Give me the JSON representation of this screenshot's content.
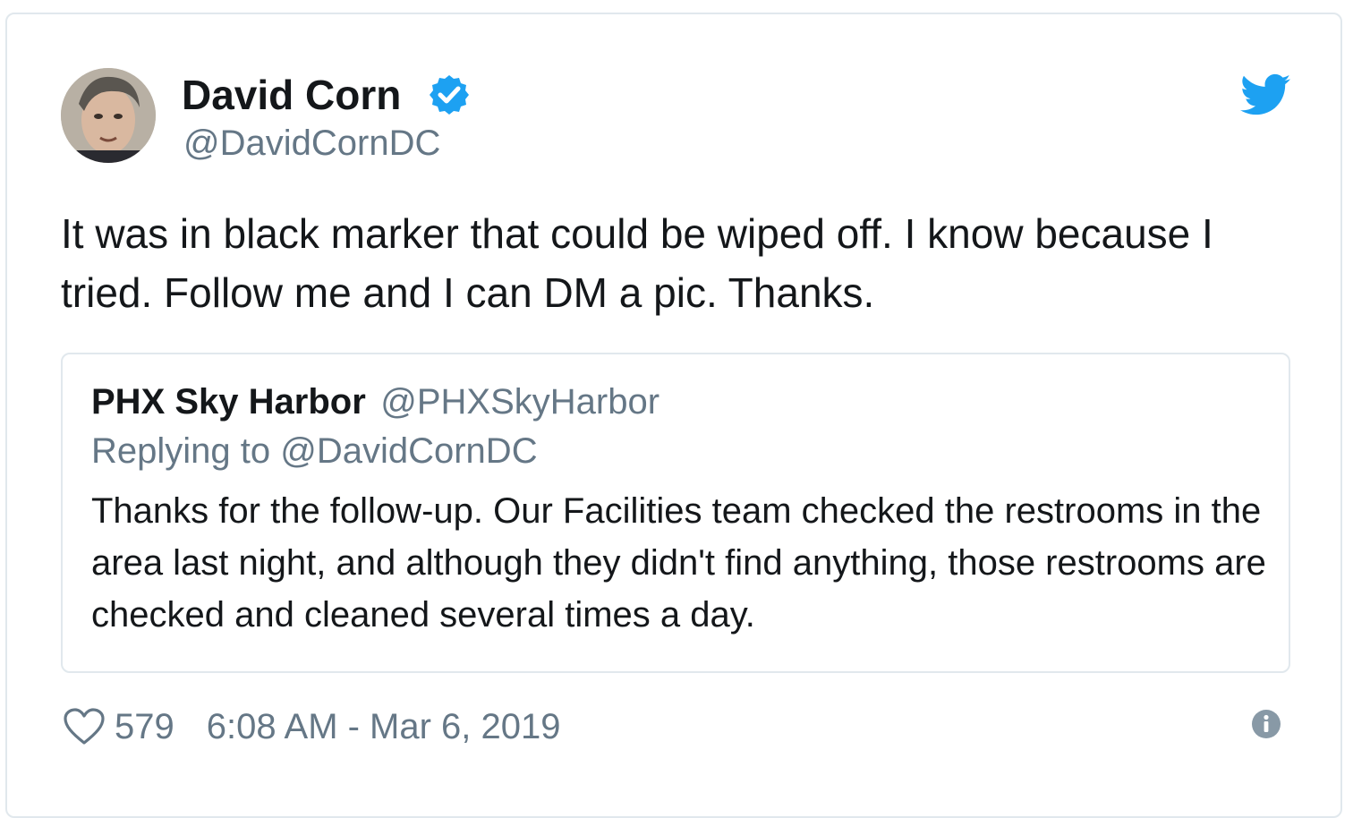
{
  "tweet": {
    "author": {
      "name": "David Corn",
      "handle": "@DavidCornDC",
      "verified": true
    },
    "text": "It was in black marker that could be wiped off. I know because I tried. Follow me and I can DM a pic. Thanks.",
    "quoted": {
      "name": "PHX Sky Harbor",
      "handle": "@PHXSkyHarbor",
      "replying_to": "Replying to @DavidCornDC",
      "text": "Thanks for the follow-up. Our Facilities team checked the restrooms in the area last night, and although they didn't find anything, those restrooms are checked and cleaned several times a day."
    },
    "likes": "579",
    "timestamp": "6:08 AM - Mar 6, 2019"
  },
  "icons": {
    "verified": "verified-badge-icon",
    "brand": "twitter-bird-icon",
    "like": "heart-icon",
    "info": "info-icon"
  },
  "colors": {
    "twitter_blue": "#1da1f2",
    "text_primary": "#14171a",
    "text_secondary": "#657786",
    "border": "#e1e8ed"
  }
}
